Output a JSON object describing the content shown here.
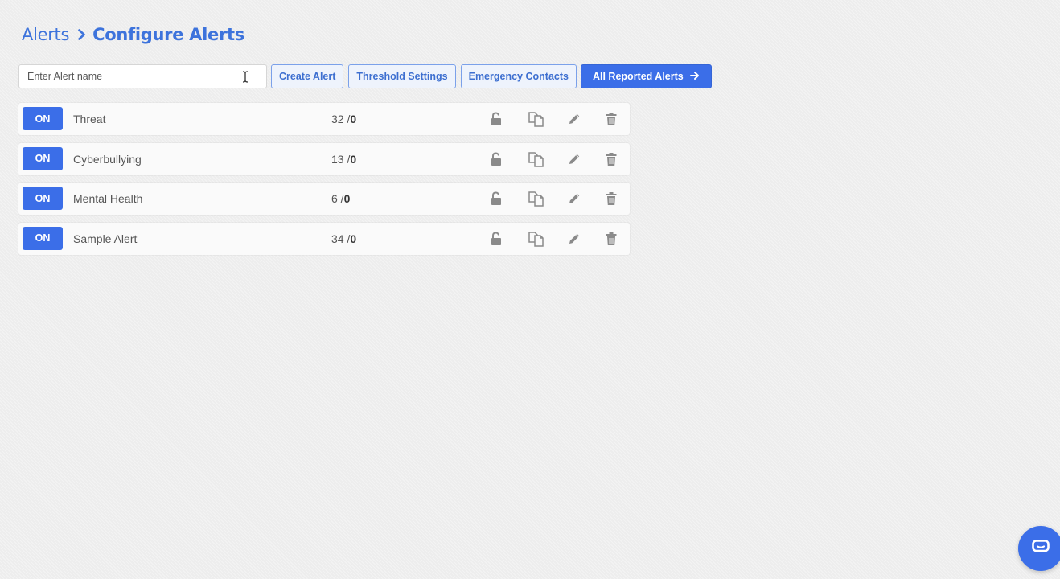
{
  "breadcrumb": {
    "root": "Alerts",
    "current": "Configure Alerts"
  },
  "toolbar": {
    "search_placeholder": "Enter Alert name",
    "create_label": "Create Alert",
    "threshold_label": "Threshold Settings",
    "emergency_label": "Emergency Contacts",
    "reported_label": "All Reported Alerts"
  },
  "alerts": [
    {
      "status": "ON",
      "name": "Threat",
      "count": "32 /",
      "total": "0"
    },
    {
      "status": "ON",
      "name": "Cyberbullying",
      "count": "13 /",
      "total": "0"
    },
    {
      "status": "ON",
      "name": "Mental Health",
      "count": "6 /",
      "total": "0"
    },
    {
      "status": "ON",
      "name": "Sample Alert",
      "count": "34 /",
      "total": "0"
    }
  ],
  "icons": {
    "breadcrumb_separator": "chevron-right-icon",
    "reported_button": "arrow-right-icon",
    "row_actions": [
      "unlock-icon",
      "copy-icon",
      "pencil-icon",
      "trash-icon"
    ],
    "chat": "chat-icon"
  },
  "colors": {
    "accent": "#3b6ee8",
    "breadcrumb": "#3d73dc",
    "icon_gray": "#8a8a8a"
  }
}
